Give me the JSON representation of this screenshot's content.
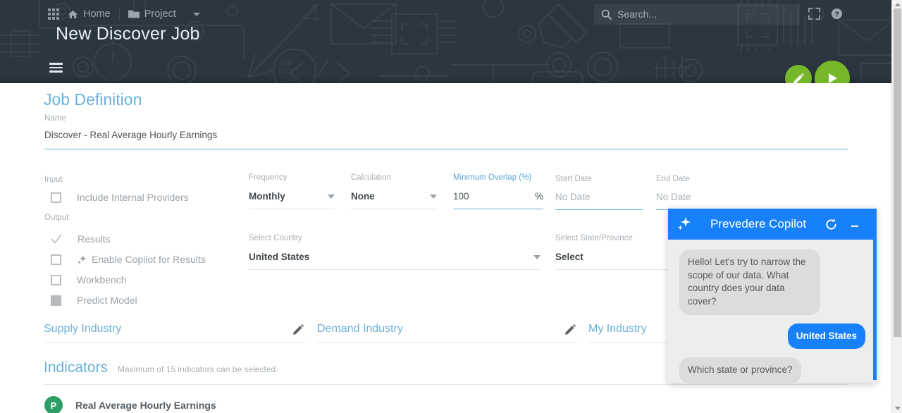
{
  "header": {
    "apps_icon": "apps-grid-icon",
    "nav": [
      {
        "label": "Home",
        "icon": "home-icon"
      },
      {
        "label": "Project",
        "icon": "folder-icon"
      }
    ],
    "dropdown_icon": "chevron-down-icon",
    "page_title": "New Discover Job",
    "menu_icon": "hamburger-menu-icon",
    "background_color": "#2b3640"
  },
  "search": {
    "placeholder": "Search...",
    "icon": "search-icon",
    "fullscreen_icon": "fullscreen-icon",
    "help_icon": "help-circle-icon"
  },
  "fabs": {
    "edit_label": "edit-job",
    "run_label": "run-job",
    "color": "#76b72a"
  },
  "job_definition": {
    "title": "Job Definition",
    "name_label": "Name",
    "name_value": "Discover - Real Average Hourly Earnings"
  },
  "input_section": {
    "label": "Input",
    "items": [
      {
        "label": "Include Internal Providers",
        "state": "unchecked"
      }
    ]
  },
  "output_section": {
    "label": "Output",
    "items": [
      {
        "label": "Results",
        "state": "checked"
      },
      {
        "label": "Enable Copilot for Results",
        "state": "unchecked",
        "icon": "sparkle-icon"
      },
      {
        "label": "Workbench",
        "state": "unchecked"
      },
      {
        "label": "Predict Model",
        "state": "disabled"
      }
    ]
  },
  "fields": {
    "frequency": {
      "label": "Frequency",
      "value": "Monthly",
      "type": "select"
    },
    "calculation": {
      "label": "Calculation",
      "value": "None",
      "type": "select"
    },
    "minimum_overlap": {
      "label": "Minimum Overlap (%)",
      "value": "100",
      "suffix": "%",
      "active": true
    },
    "start_date": {
      "label": "Start Date",
      "value": "No Date"
    },
    "end_date": {
      "label": "End Date",
      "value": "No Date"
    },
    "select_country": {
      "label": "Select Country",
      "value": "United States",
      "type": "select"
    },
    "select_state": {
      "label": "Select State/Province",
      "value": "Select"
    }
  },
  "industries": [
    {
      "label": "Supply Industry",
      "icon": "pencil-icon"
    },
    {
      "label": "Demand Industry",
      "icon": "pencil-icon"
    },
    {
      "label": "My Industry",
      "icon": "pencil-icon"
    }
  ],
  "indicators": {
    "title": "Indicators",
    "note": "Maximum of 15 indicators can be selected.",
    "rows": [
      {
        "avatar": "P",
        "name": "Real Average Hourly Earnings"
      }
    ]
  },
  "copilot": {
    "title": "Prevedere Copilot",
    "logo_icon": "sparkle-icon",
    "refresh_icon": "refresh-icon",
    "minimize_icon": "minimize-icon",
    "accent_color": "#1681fb",
    "messages": [
      {
        "from": "bot",
        "text": "Hello! Let's try to narrow the scope of our data. What country does your data cover?"
      },
      {
        "from": "user",
        "text": "United States"
      },
      {
        "from": "bot",
        "text": "Which state or province?"
      }
    ]
  },
  "scrollbar": {
    "name": "page-scrollbar"
  }
}
